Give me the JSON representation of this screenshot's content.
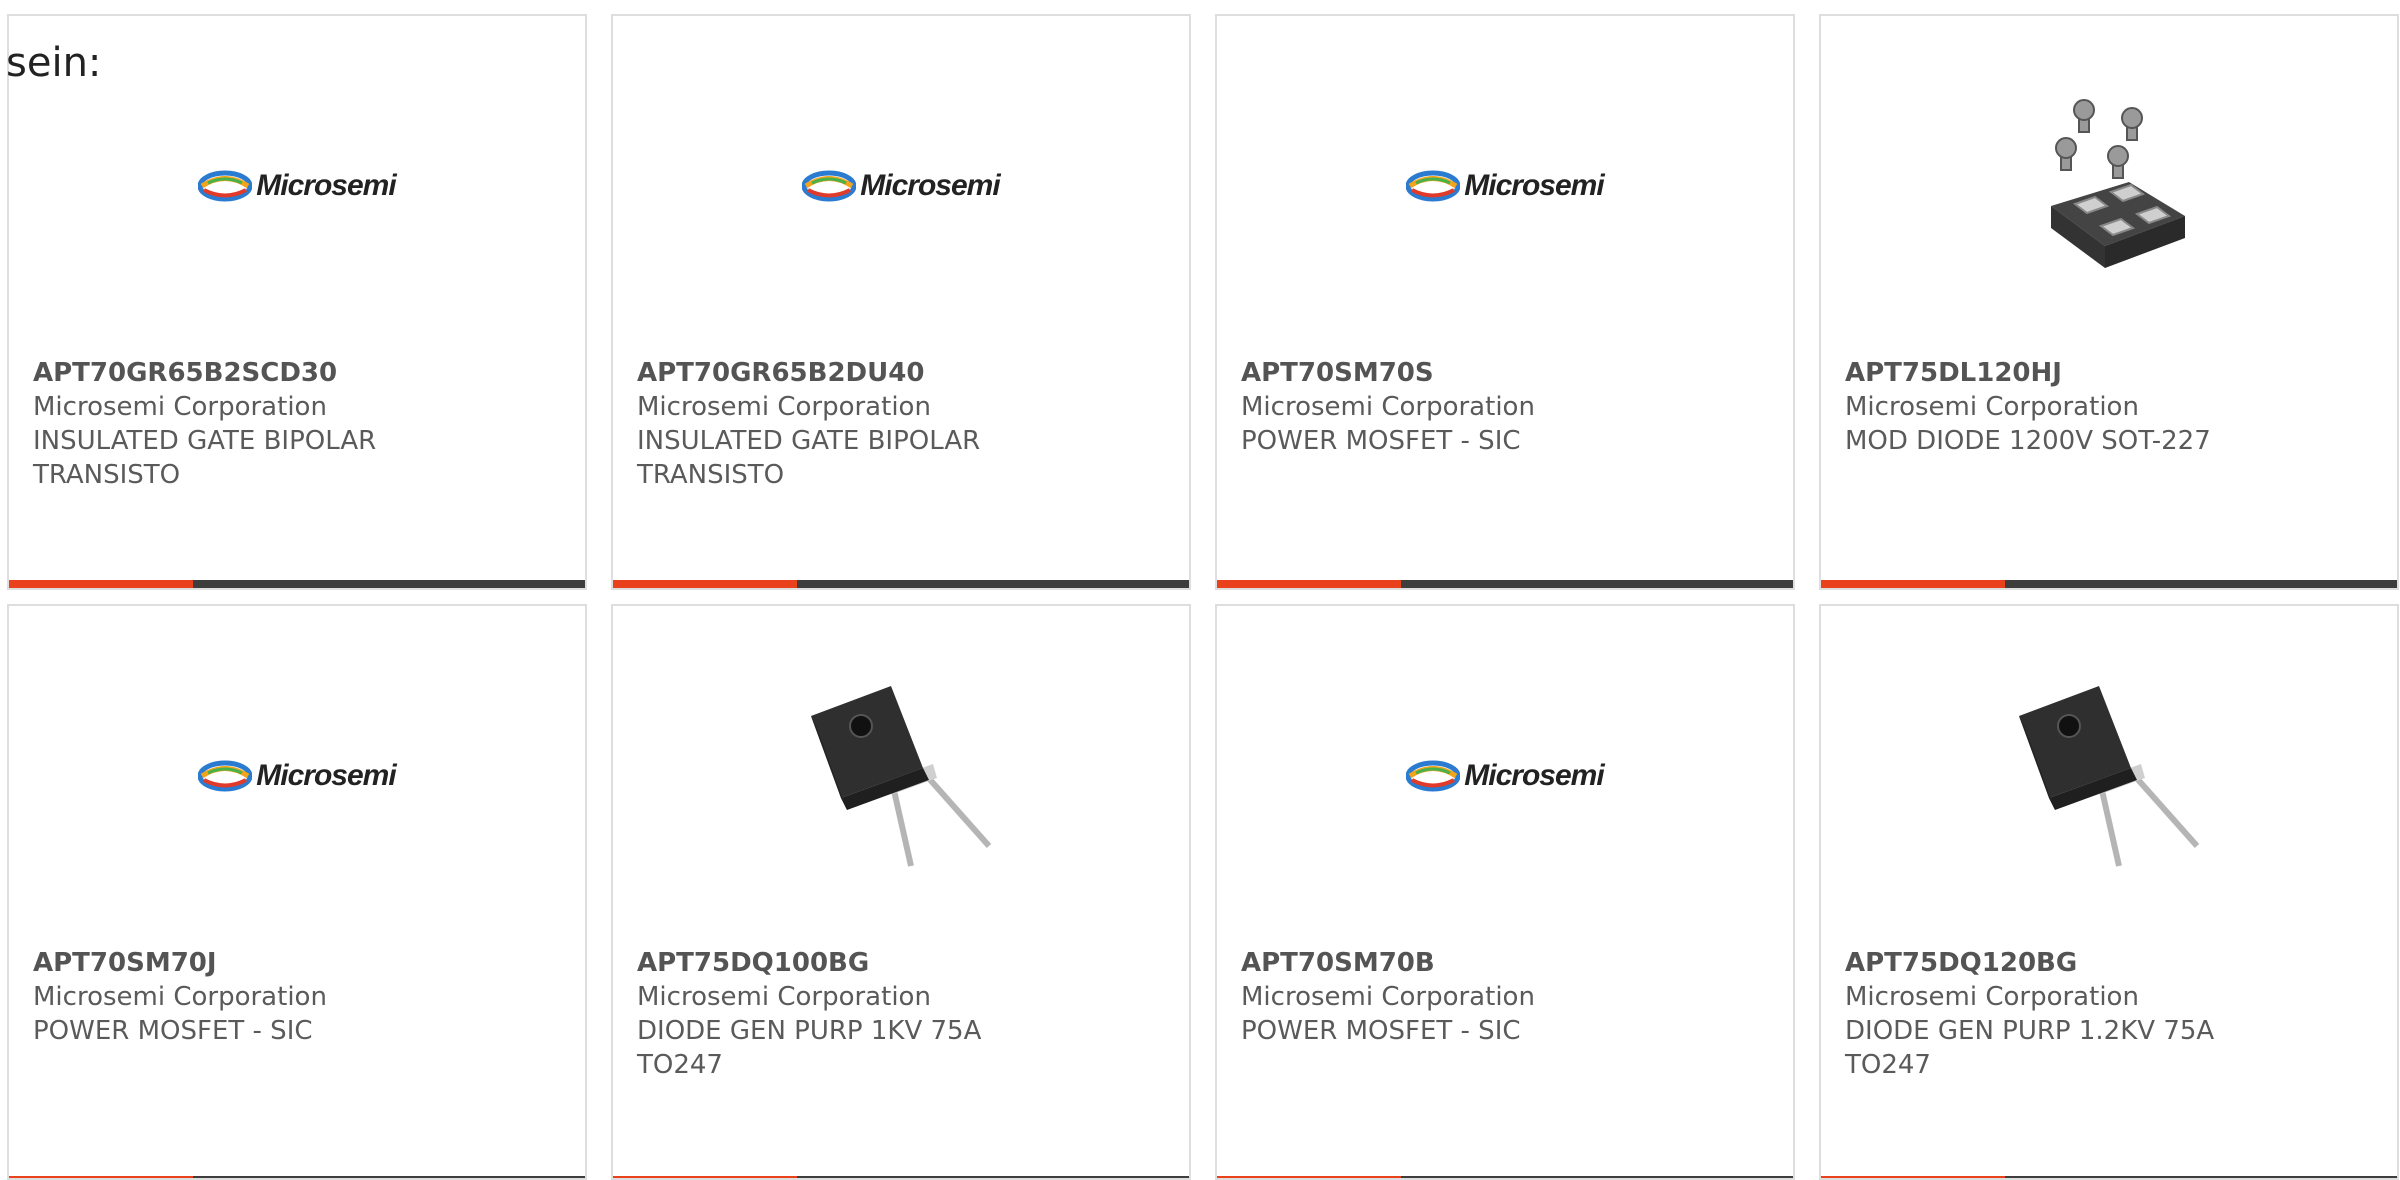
{
  "intro_text": "sein:",
  "products": [
    {
      "part": "APT70GR65B2SCD30",
      "manufacturer": "Microsemi Corporation",
      "description": "INSULATED GATE BIPOLAR TRANSISTO",
      "image": "microsemi-logo",
      "logo_text": "Microsemi"
    },
    {
      "part": "APT70GR65B2DU40",
      "manufacturer": "Microsemi Corporation",
      "description": "INSULATED GATE BIPOLAR TRANSISTO",
      "image": "microsemi-logo",
      "logo_text": "Microsemi"
    },
    {
      "part": "APT70SM70S",
      "manufacturer": "Microsemi Corporation",
      "description": "POWER MOSFET - SIC",
      "image": "microsemi-logo",
      "logo_text": "Microsemi"
    },
    {
      "part": "APT75DL120HJ",
      "manufacturer": "Microsemi Corporation",
      "description": "MOD DIODE 1200V SOT-227",
      "image": "sot227-module-photo",
      "logo_text": ""
    },
    {
      "part": "APT70SM70J",
      "manufacturer": "Microsemi Corporation",
      "description": "POWER MOSFET - SIC",
      "image": "microsemi-logo",
      "logo_text": "Microsemi"
    },
    {
      "part": "APT75DQ100BG",
      "manufacturer": "Microsemi Corporation",
      "description": "DIODE GEN PURP 1KV 75A TO247",
      "image": "to247-diode-photo",
      "logo_text": ""
    },
    {
      "part": "APT70SM70B",
      "manufacturer": "Microsemi Corporation",
      "description": "POWER MOSFET - SIC",
      "image": "microsemi-logo",
      "logo_text": "Microsemi"
    },
    {
      "part": "APT75DQ120BG",
      "manufacturer": "Microsemi Corporation",
      "description": "DIODE GEN PURP 1.2KV 75A TO247",
      "image": "to247-diode-photo",
      "logo_text": ""
    }
  ],
  "colors": {
    "accent_bar": "#e8411c",
    "dark_bar": "#3d3d3d",
    "card_border": "#dedede",
    "text": "#5a5a5a"
  }
}
